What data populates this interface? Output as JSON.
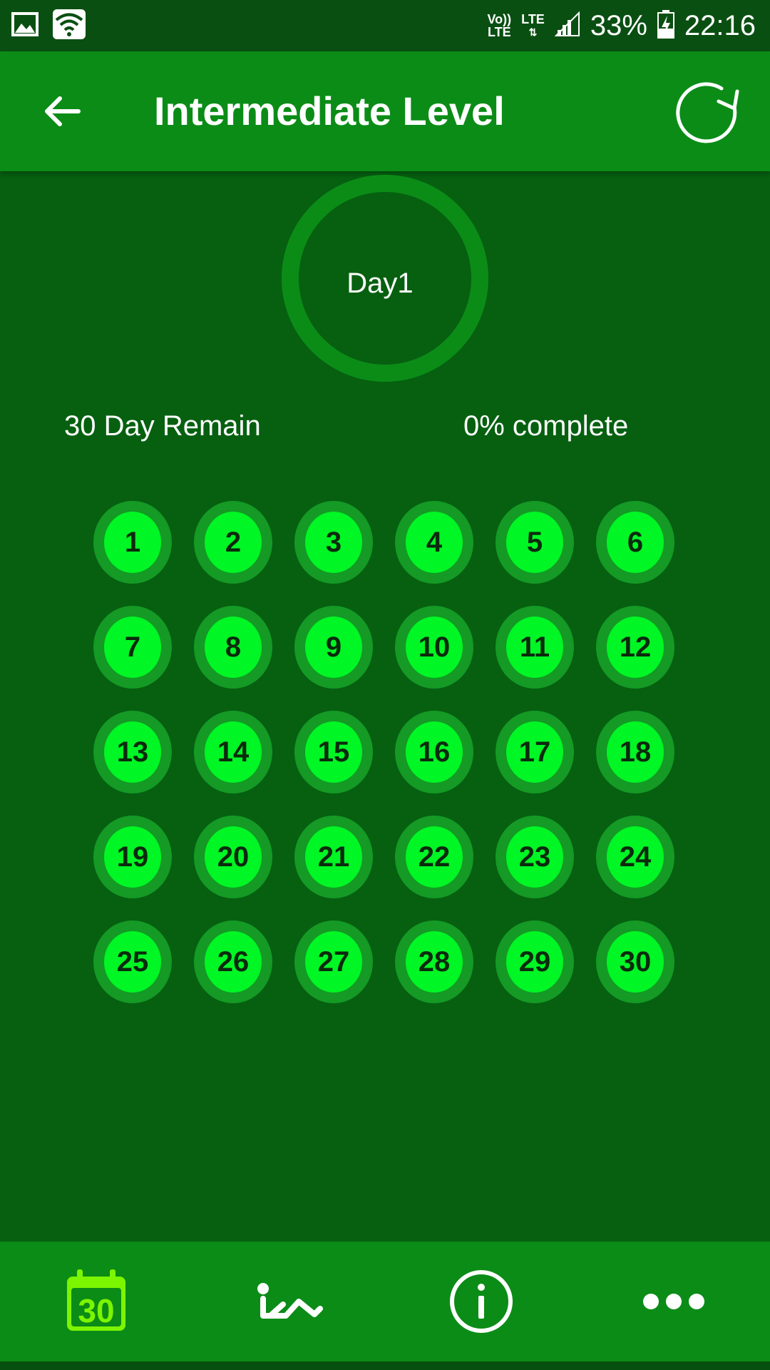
{
  "status_bar": {
    "volte_top": "Vo))",
    "volte_bottom": "LTE",
    "network": "LTE",
    "battery": "33%",
    "time": "22:16",
    "icons": [
      "image-icon",
      "wifi-icon",
      "signal-icon",
      "battery-charging-icon"
    ]
  },
  "app_bar": {
    "title": "Intermediate Level",
    "back_icon": "arrow-left-icon",
    "refresh_icon": "refresh-icon"
  },
  "progress": {
    "current_day_label": "Day1",
    "remain_text": "30 Day Remain",
    "complete_text": "0% complete",
    "percent_complete": 0
  },
  "days": [
    "1",
    "2",
    "3",
    "4",
    "5",
    "6",
    "7",
    "8",
    "9",
    "10",
    "11",
    "12",
    "13",
    "14",
    "15",
    "16",
    "17",
    "18",
    "19",
    "20",
    "21",
    "22",
    "23",
    "24",
    "25",
    "26",
    "27",
    "28",
    "29",
    "30"
  ],
  "bottom_nav": {
    "calendar_number": "30",
    "items": [
      "calendar-30-icon",
      "exercise-icon",
      "info-icon",
      "more-icon"
    ]
  },
  "colors": {
    "background": "#066010",
    "app_bar": "#0b8c17",
    "status_bar": "#0a4f12",
    "day_ring": "#149a25",
    "day_fill": "#00f624",
    "calendar_icon": "#7cf500"
  }
}
